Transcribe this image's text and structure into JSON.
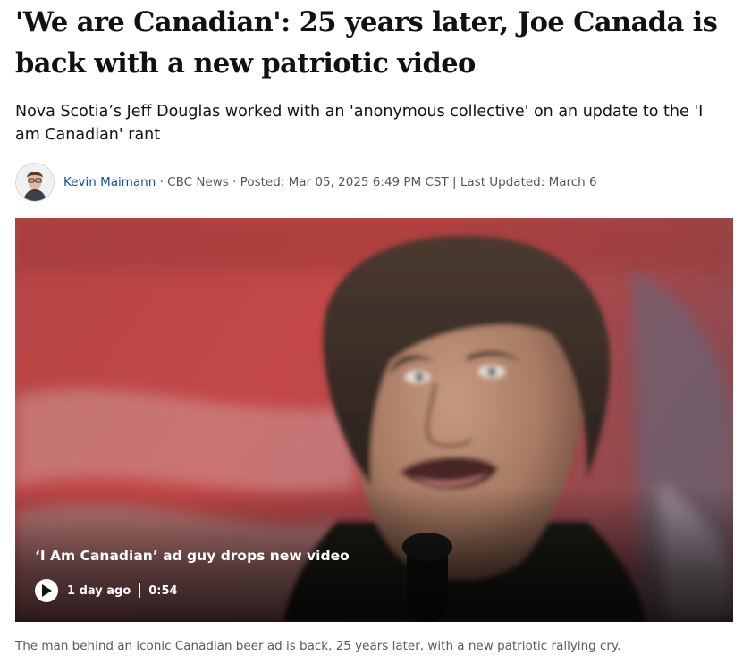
{
  "article": {
    "headline": "'We are Canadian': 25 years later, Joe Canada is back with a new patriotic video",
    "deck": "Nova Scotia’s Jeff Douglas worked with an 'anonymous collective' on an update to the 'I am Canadian' rant",
    "byline": {
      "author": "Kevin Maimann",
      "outlet": " · CBC News · Posted: Mar 05, 2025 6:49 PM CST | Last Updated: March 6",
      "avatar_icon": "author-headshot-icon"
    }
  },
  "video": {
    "title": "‘I Am Canadian’ ad guy drops new video",
    "age": "1 day ago",
    "duration": "0:54",
    "play_icon": "play-icon"
  },
  "caption": "The man behind an iconic Canadian beer ad is back, 25 years later, with a new patriotic rallying cry.",
  "colors": {
    "link": "#0b4fa8",
    "text": "#111111",
    "muted": "#595959",
    "flag_red": "#c73a3a"
  }
}
